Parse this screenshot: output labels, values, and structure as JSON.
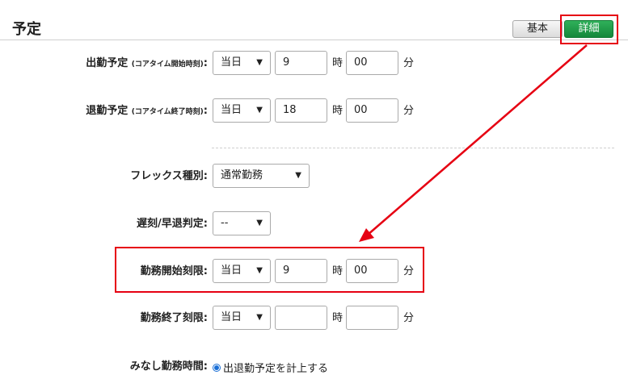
{
  "section": {
    "title": "予定"
  },
  "tabs": {
    "basic": "基本",
    "detail": "詳細"
  },
  "rows": {
    "start": {
      "label": "出勤予定",
      "note": "(コアタイム開始時刻)",
      "colon": ":",
      "day": "当日",
      "hour": "9",
      "minute": "00"
    },
    "end": {
      "label": "退勤予定",
      "note": "(コアタイム終了時刻)",
      "colon": ":",
      "day": "当日",
      "hour": "18",
      "minute": "00"
    },
    "flex": {
      "label": "フレックス種別:",
      "value": "通常勤務"
    },
    "late": {
      "label": "遅刻/早退判定:",
      "value": "--"
    },
    "work_start_limit": {
      "label": "勤務開始刻限:",
      "day": "当日",
      "hour": "9",
      "minute": "00"
    },
    "work_end_limit": {
      "label": "勤務終了刻限:",
      "day": "当日",
      "hour": "",
      "minute": ""
    },
    "deemed": {
      "label": "みなし勤務時間:",
      "option": "出退勤予定を計上する"
    }
  },
  "units": {
    "hour": "時",
    "minute": "分"
  },
  "caret_icon": "chevron-down-icon",
  "colors": {
    "accent_red": "#e60012",
    "tab_green": "#1f9a48"
  }
}
